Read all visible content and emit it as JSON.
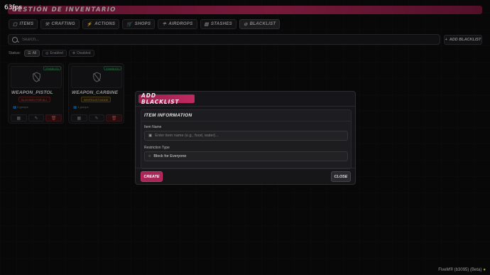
{
  "overlay_fps": "63fps",
  "app": {
    "title": "GESTIÓN DE INVENTARIO"
  },
  "tabs": [
    {
      "label": "ITEMS",
      "icon": "box-icon",
      "glyph": "▢"
    },
    {
      "label": "CRAFTING",
      "icon": "hammer-icon",
      "glyph": "⚒"
    },
    {
      "label": "ACTIONS",
      "icon": "bolt-icon",
      "glyph": "⚡"
    },
    {
      "label": "SHOPS",
      "icon": "cart-icon",
      "glyph": "🛒"
    },
    {
      "label": "AIRDROPS",
      "icon": "parachute-icon",
      "glyph": "☂"
    },
    {
      "label": "STASHES",
      "icon": "archive-icon",
      "glyph": "▤"
    },
    {
      "label": "BLACKLIST",
      "icon": "ban-icon",
      "glyph": "⊘",
      "active": true
    }
  ],
  "search": {
    "placeholder": "Search..."
  },
  "add_button": {
    "label": "ADD BLACKLIST"
  },
  "status_filter": {
    "label": "Status:",
    "options": [
      {
        "label": "All",
        "active": true
      },
      {
        "label": "Enabled"
      },
      {
        "label": "Disabled"
      }
    ]
  },
  "items": [
    {
      "name": "WEAPON_PISTOL",
      "badge": "ENABLED",
      "restriction": "BLOCKED FOR ALL",
      "restriction_color": "#e05555",
      "groups": "0 groups"
    },
    {
      "name": "WEAPON_CARBINE",
      "badge": "ENABLED",
      "restriction": "WHITELIST MODE",
      "restriction_color": "#d8a93a",
      "groups": "1 groups"
    }
  ],
  "modal": {
    "title": "ADD BLACKLIST",
    "section_title": "ITEM INFORMATION",
    "item_name_label": "Item Name",
    "item_name_placeholder": "Enter item name (e.g., food, water)...",
    "restriction_label": "Restriction Type",
    "restriction_value": "Block for Everyone",
    "create_label": "CREATE",
    "close_label": "CLOSE"
  },
  "watermark": "FiveM® (b3095) (Beta)",
  "colors": {
    "accent": "#a82658",
    "enabled": "#3fb76a",
    "danger": "#d85a5a"
  }
}
